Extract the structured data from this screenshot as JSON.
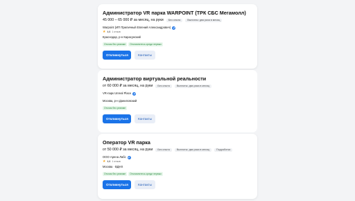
{
  "vacancies": [
    {
      "title": "Администратор VR парка WARPOINT (ТРК СБС Мегамолл)",
      "salary": "45 000 – 65 000 ₽ за месяц, на руки",
      "tags": [
        "Без опыта",
        "Выплаты: два раза в месяц"
      ],
      "employer": "Warpoint (ИП Приличный Евгений Александрович)",
      "rating": "4,6",
      "rating_note": "1 отзыв",
      "address": "Краснодар, р-н Карасунский",
      "badges": [
        "Отклик без резюме",
        "Откликнитесь среди первых"
      ],
      "apply_label": "Откликнуться",
      "contacts_label": "Контакты"
    },
    {
      "title": "Администратор виртуальной реальности",
      "salary": "от 60 000 ₽ за месяц, на руки",
      "tags": [
        "Без опыта",
        "Выплаты: два раза в месяц"
      ],
      "employer": "VR-парк Unreal Place",
      "address": "Москва, р-н Даниловский",
      "badges": [
        "Отклик без резюме"
      ],
      "apply_label": "Откликнуться",
      "contacts_label": "Контакты"
    },
    {
      "title": "Оператор VR парка",
      "salary": "от 50 000 ₽ за месяц, на руки",
      "tags": [
        "Без опыта",
        "Выплаты: два раза в месяц",
        "Подработка"
      ],
      "employer": "ООО Арена Лабс",
      "rating": "4,6",
      "rating_note": "1 отзыв",
      "address": "Москва · ВДНХ",
      "badges": [
        "Отклик без резюме",
        "Откликнитесь среди первых"
      ],
      "apply_label": "Откликнуться",
      "contacts_label": "Контакты"
    }
  ],
  "colors": {
    "primary": "#1a73e8",
    "verified": "#2b7de9",
    "badge_green": "#2b8a3e",
    "star": "#f5a623"
  }
}
